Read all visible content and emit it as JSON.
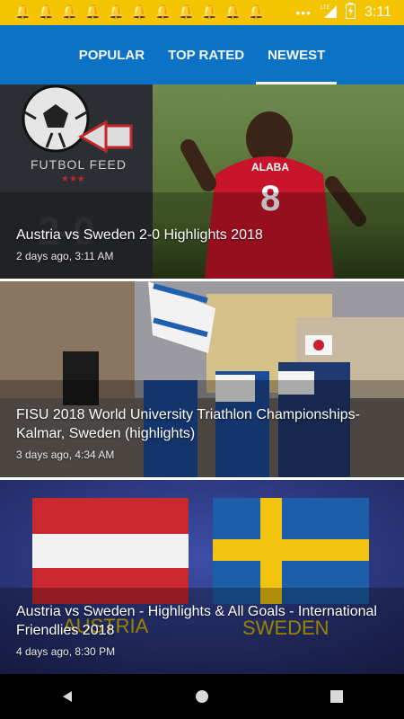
{
  "status_bar": {
    "time": "3:11",
    "notification_icons": [
      "bell-icon",
      "bell-icon",
      "bell-icon",
      "bell-icon",
      "bell-icon",
      "bell-icon",
      "bell-icon",
      "bell-icon",
      "bell-icon",
      "bell-icon",
      "bell-icon"
    ],
    "network": "LTE"
  },
  "tabs": [
    {
      "label": "POPULAR"
    },
    {
      "label": "TOP RATED"
    },
    {
      "label": "NEWEST",
      "active": true
    }
  ],
  "cards": [
    {
      "title": "Austria vs Sweden 2-0 Highlights 2018",
      "subtitle": "2 days ago, 3:11 AM",
      "logo_text": "FUTBOL FEED",
      "score_text": "2-0",
      "jersey_name": "ALABA",
      "jersey_number": "8"
    },
    {
      "title": "FISU 2018 World University Triathlon Championships- Kalmar, Sweden (highlights)",
      "subtitle": "3 days ago, 4:34 AM"
    },
    {
      "title": "Austria vs Sweden - Highlights & All Goals - International Friendlies 2018",
      "subtitle": "4 days ago, 8:30 PM",
      "overlay_left": "AUSTRIA",
      "overlay_right": "SWEDEN"
    }
  ],
  "colors": {
    "status_bar": "#f5c400",
    "app_bar": "#0b72c6"
  }
}
